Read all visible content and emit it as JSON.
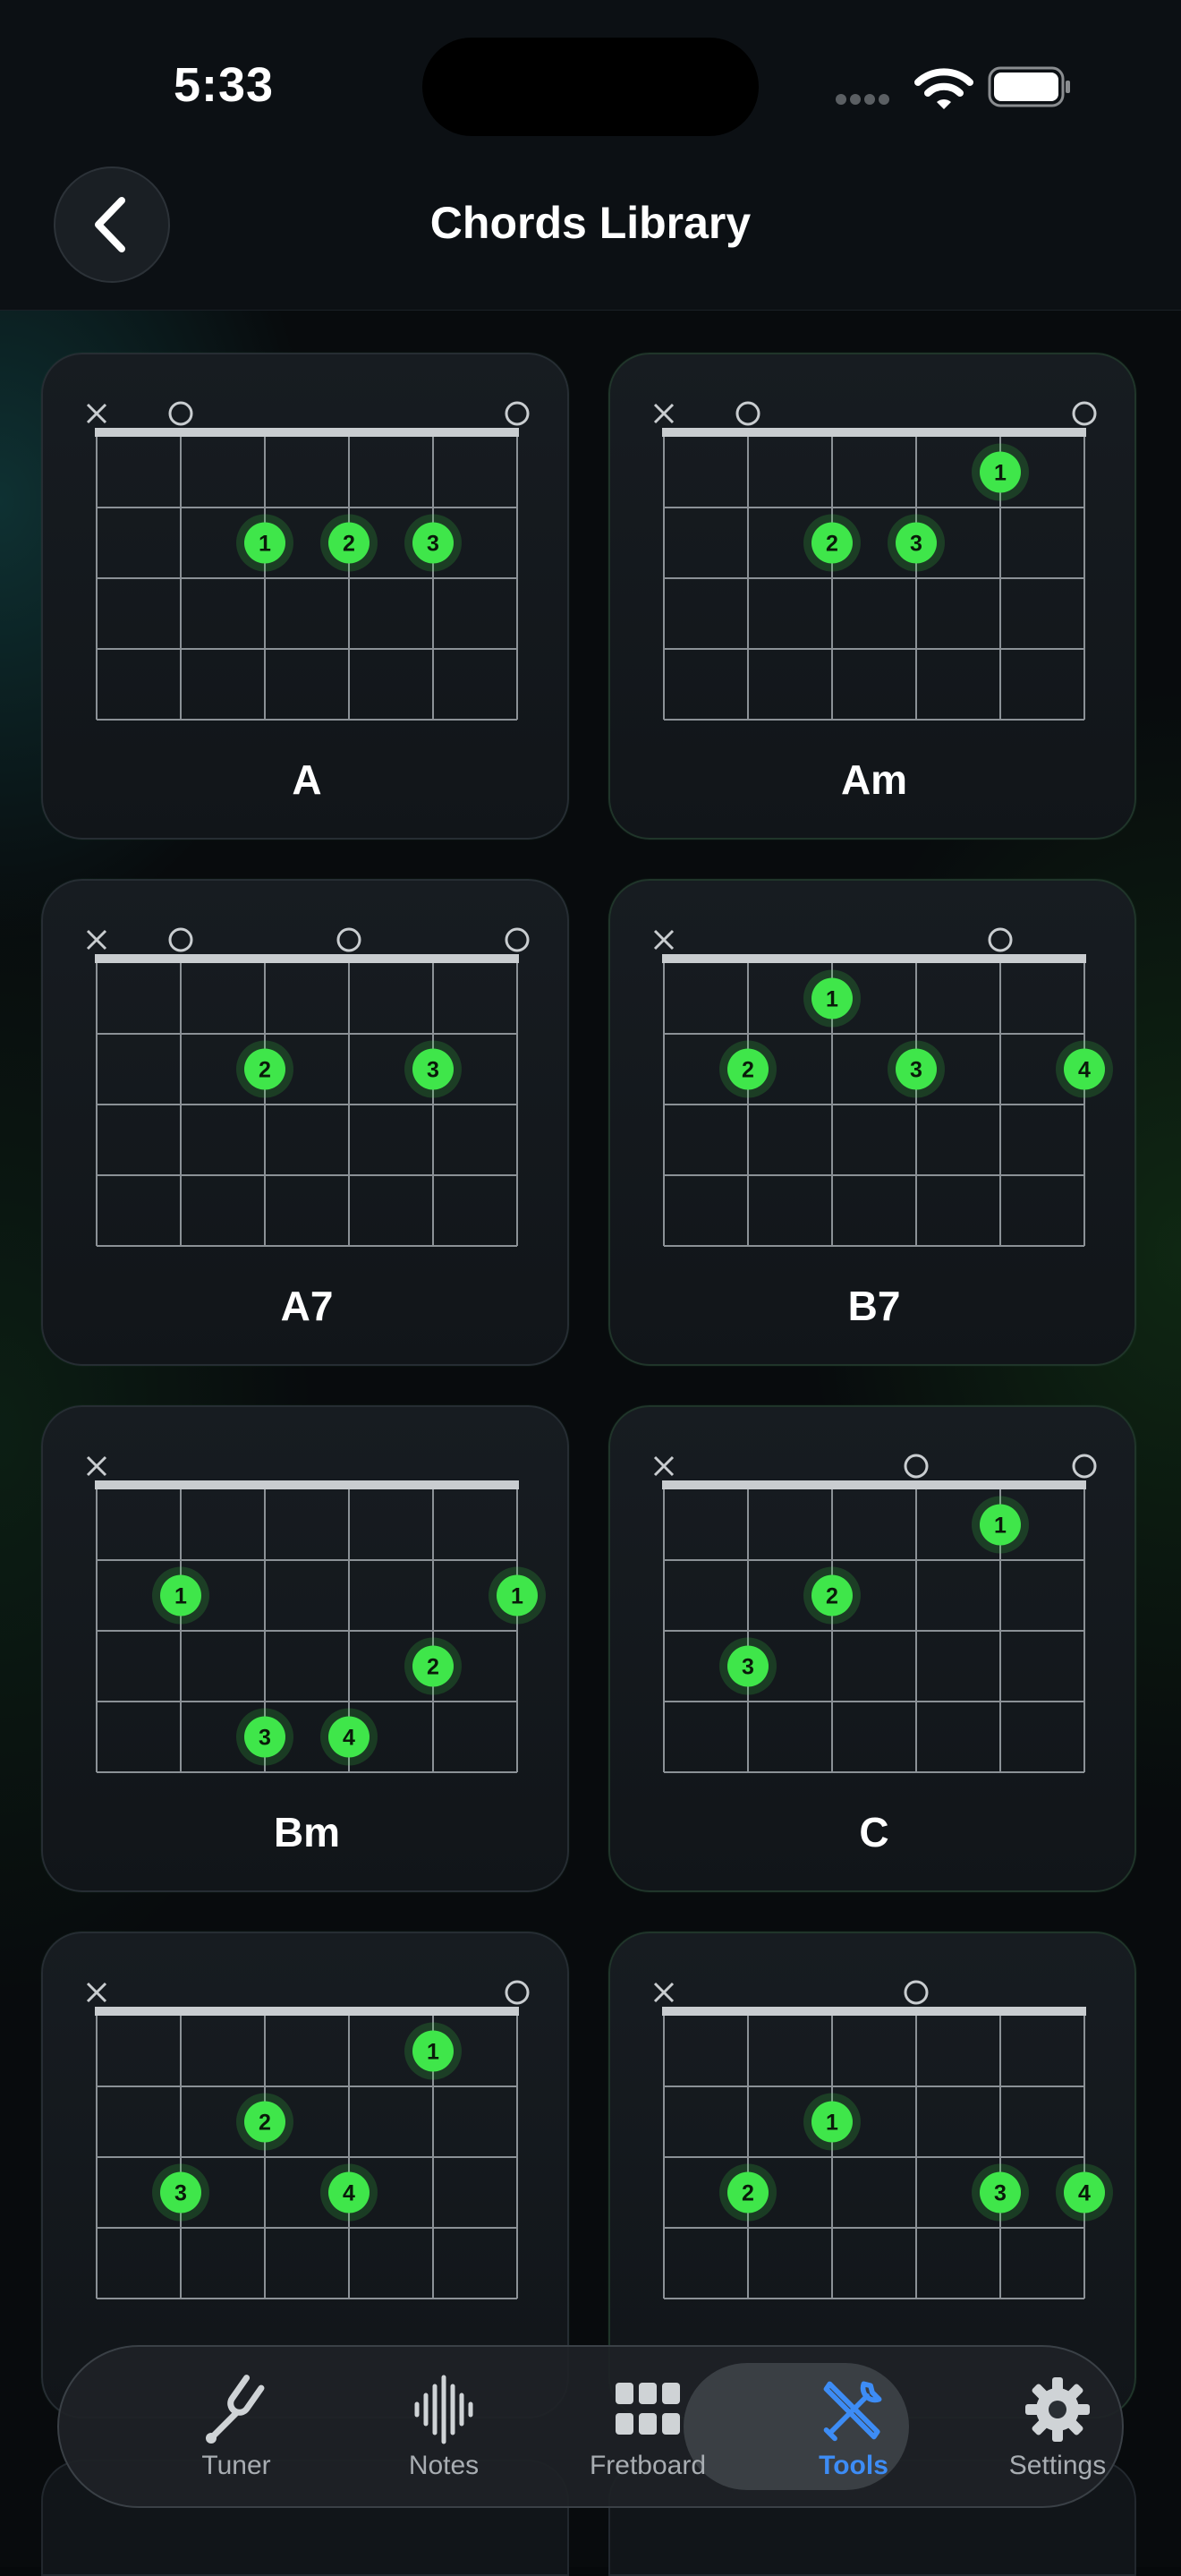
{
  "status": {
    "time": "5:33"
  },
  "header": {
    "title": "Chords Library"
  },
  "colors": {
    "accent_green": "#3fe64a",
    "tab_active": "#3d8cf5"
  },
  "chords": [
    {
      "name": "A",
      "markers": [
        "x",
        "o",
        "",
        "",
        "",
        "o"
      ],
      "dots": [
        [
          2,
          2,
          "1"
        ],
        [
          3,
          2,
          "2"
        ],
        [
          4,
          2,
          "3"
        ]
      ]
    },
    {
      "name": "Am",
      "markers": [
        "x",
        "o",
        "",
        "",
        "",
        "o"
      ],
      "dots": [
        [
          4,
          1,
          "1"
        ],
        [
          2,
          2,
          "2"
        ],
        [
          3,
          2,
          "3"
        ]
      ]
    },
    {
      "name": "A7",
      "markers": [
        "x",
        "o",
        "",
        "o",
        "",
        "o"
      ],
      "dots": [
        [
          2,
          2,
          "2"
        ],
        [
          4,
          2,
          "3"
        ]
      ]
    },
    {
      "name": "B7",
      "markers": [
        "x",
        "",
        "",
        "",
        "o",
        ""
      ],
      "dots": [
        [
          2,
          1,
          "1"
        ],
        [
          1,
          2,
          "2"
        ],
        [
          3,
          2,
          "3"
        ],
        [
          5,
          2,
          "4"
        ]
      ]
    },
    {
      "name": "Bm",
      "markers": [
        "x",
        "",
        "",
        "",
        "",
        ""
      ],
      "dots": [
        [
          1,
          2,
          "1"
        ],
        [
          5,
          2,
          "1"
        ],
        [
          4,
          3,
          "2"
        ],
        [
          2,
          4,
          "3"
        ],
        [
          3,
          4,
          "4"
        ]
      ]
    },
    {
      "name": "C",
      "markers": [
        "x",
        "",
        "",
        "o",
        "",
        "o"
      ],
      "dots": [
        [
          4,
          1,
          "1"
        ],
        [
          2,
          2,
          "2"
        ],
        [
          1,
          3,
          "3"
        ]
      ]
    },
    {
      "name": "",
      "markers": [
        "x",
        "",
        "",
        "",
        "",
        "o"
      ],
      "dots": [
        [
          4,
          1,
          "1"
        ],
        [
          2,
          2,
          "2"
        ],
        [
          1,
          3,
          "3"
        ],
        [
          3,
          3,
          "4"
        ]
      ]
    },
    {
      "name": "",
      "markers": [
        "x",
        "",
        "",
        "o",
        "",
        ""
      ],
      "dots": [
        [
          2,
          2,
          "1"
        ],
        [
          1,
          3,
          "2"
        ],
        [
          4,
          3,
          "3"
        ],
        [
          5,
          3,
          "4"
        ]
      ]
    }
  ],
  "tabs": [
    {
      "label": "Tuner",
      "icon": "tuning-fork-icon"
    },
    {
      "label": "Notes",
      "icon": "waveform-icon"
    },
    {
      "label": "Fretboard",
      "icon": "grid-dots-icon"
    },
    {
      "label": "Tools",
      "icon": "tools-icon",
      "active": true
    },
    {
      "label": "Settings",
      "icon": "gear-icon"
    }
  ]
}
